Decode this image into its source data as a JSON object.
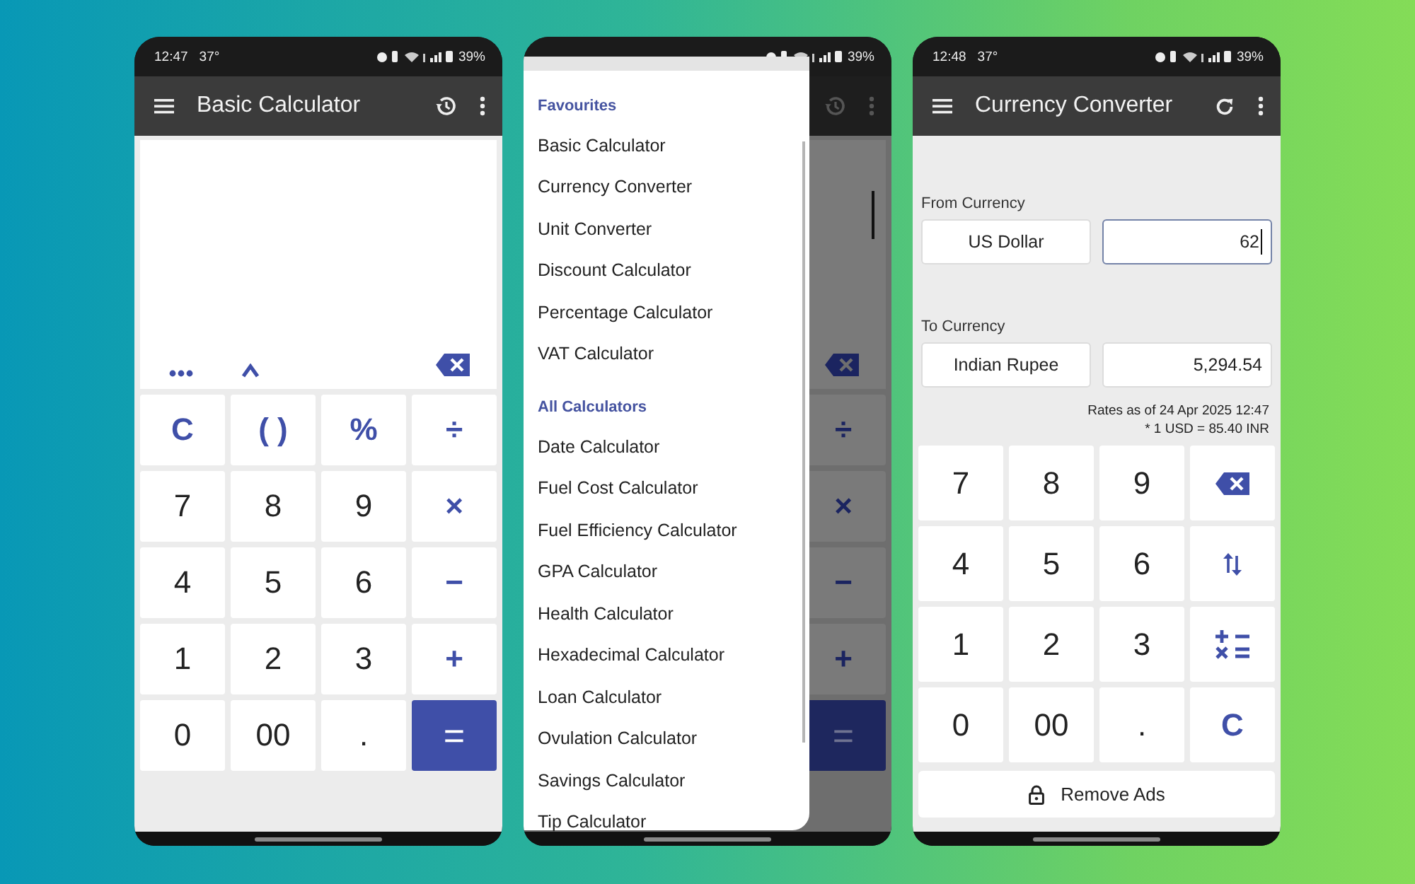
{
  "phones": [
    {
      "kind": "calculator",
      "status": {
        "time": "12:47",
        "temperature": "37°",
        "battery": "39%"
      },
      "app_bar": {
        "title": "Basic Calculator",
        "kind": "history"
      },
      "keys": [
        {
          "label": "C",
          "kind": "op"
        },
        {
          "label": "( )",
          "kind": "op"
        },
        {
          "label": "%",
          "kind": "op"
        },
        {
          "label": "÷",
          "kind": "op"
        },
        {
          "label": "7",
          "kind": "digit"
        },
        {
          "label": "8",
          "kind": "digit"
        },
        {
          "label": "9",
          "kind": "digit"
        },
        {
          "label": "×",
          "kind": "op"
        },
        {
          "label": "4",
          "kind": "digit"
        },
        {
          "label": "5",
          "kind": "digit"
        },
        {
          "label": "6",
          "kind": "digit"
        },
        {
          "label": "−",
          "kind": "op"
        },
        {
          "label": "1",
          "kind": "digit"
        },
        {
          "label": "2",
          "kind": "digit"
        },
        {
          "label": "3",
          "kind": "digit"
        },
        {
          "label": "+",
          "kind": "op"
        },
        {
          "label": "0",
          "kind": "digit"
        },
        {
          "label": "00",
          "kind": "digit"
        },
        {
          "label": ".",
          "kind": "digit"
        },
        {
          "label": "=",
          "kind": "equals"
        }
      ]
    },
    {
      "kind": "menu",
      "status": {
        "battery": "39%"
      },
      "app_bar": {
        "kind": "history"
      },
      "keys": [
        {
          "label": "÷",
          "kind": "op"
        },
        {
          "label": "×",
          "kind": "op"
        },
        {
          "label": "−",
          "kind": "op"
        },
        {
          "label": "+",
          "kind": "op"
        },
        {
          "label": "=",
          "kind": "equals"
        }
      ],
      "drawer": {
        "sections": [
          {
            "title": "Favourites",
            "items": [
              "Basic Calculator",
              "Currency Converter",
              "Unit Converter",
              "Discount Calculator",
              "Percentage Calculator",
              "VAT Calculator"
            ]
          },
          {
            "title": "All Calculators",
            "items": [
              "Date Calculator",
              "Fuel Cost Calculator",
              "Fuel Efficiency Calculator",
              "GPA Calculator",
              "Health Calculator",
              "Hexadecimal Calculator",
              "Loan Calculator",
              "Ovulation Calculator",
              "Savings Calculator",
              "Tip Calculator"
            ]
          }
        ]
      }
    },
    {
      "kind": "converter",
      "status": {
        "time": "12:48",
        "temperature": "37°",
        "battery": "39%"
      },
      "app_bar": {
        "title": "Currency Converter",
        "kind": "refresh"
      },
      "from": {
        "label": "From Currency",
        "currency": "US Dollar",
        "value": "62",
        "focused": true
      },
      "to": {
        "label": "To Currency",
        "currency": "Indian Rupee",
        "value": "5,294.54",
        "focused": false
      },
      "rates": [
        "Rates as of 24 Apr 2025 12:47",
        "* 1 USD = 85.40 INR"
      ],
      "keys": [
        {
          "label": "7",
          "kind": "digit"
        },
        {
          "label": "8",
          "kind": "digit"
        },
        {
          "label": "9",
          "kind": "digit"
        },
        {
          "kind": "backspace"
        },
        {
          "label": "4",
          "kind": "digit"
        },
        {
          "label": "5",
          "kind": "digit"
        },
        {
          "label": "6",
          "kind": "digit"
        },
        {
          "kind": "swap"
        },
        {
          "label": "1",
          "kind": "digit"
        },
        {
          "label": "2",
          "kind": "digit"
        },
        {
          "label": "3",
          "kind": "digit"
        },
        {
          "kind": "ops"
        },
        {
          "label": "0",
          "kind": "digit"
        },
        {
          "label": "00",
          "kind": "digit"
        },
        {
          "label": ".",
          "kind": "digit"
        },
        {
          "label": "C",
          "kind": "op"
        }
      ],
      "remove_ads": "Remove Ads"
    }
  ]
}
